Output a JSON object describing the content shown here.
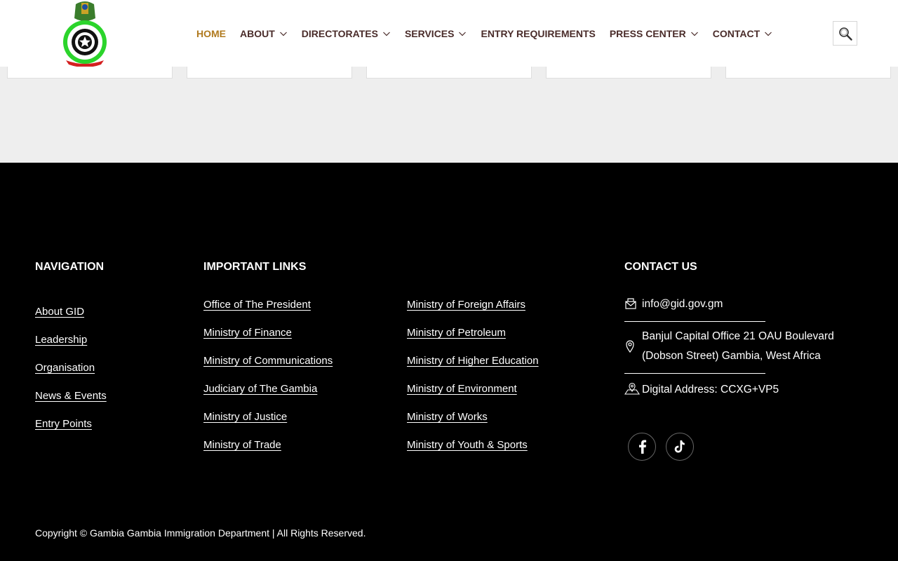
{
  "header": {
    "logo_icon": "gambia-immigration-crest-icon",
    "nav": [
      {
        "label": "HOME",
        "active": true,
        "has_dropdown": false
      },
      {
        "label": "ABOUT",
        "active": false,
        "has_dropdown": true
      },
      {
        "label": "DIRECTORATES",
        "active": false,
        "has_dropdown": true
      },
      {
        "label": "SERVICES",
        "active": false,
        "has_dropdown": true
      },
      {
        "label": "ENTRY REQUIREMENTS",
        "active": false,
        "has_dropdown": false
      },
      {
        "label": "PRESS CENTER",
        "active": false,
        "has_dropdown": true
      },
      {
        "label": "CONTACT",
        "active": false,
        "has_dropdown": true
      }
    ],
    "search_icon": "search-icon"
  },
  "footer": {
    "navigation": {
      "title": "NAVIGATION",
      "links": [
        "About GID",
        "Leadership",
        "Organisation",
        "News & Events",
        "Entry Points"
      ]
    },
    "important_links": {
      "title": "IMPORTANT LINKS",
      "col1": [
        "Office of The President",
        "Ministry of Finance",
        "Ministry of Communications",
        "Judiciary of The Gambia",
        "Ministry of Justice",
        "Ministry of Trade"
      ],
      "col2": [
        "Ministry of Foreign Affairs",
        "Ministry of Petroleum",
        "Ministry of Higher Education",
        "Ministry of Environment",
        "Ministry of Works",
        "Ministry of Youth & Sports"
      ]
    },
    "contact": {
      "title": "CONTACT US",
      "email": "info@gid.gov.gm",
      "address_line1": "Banjul Capital Office 21 OAU Boulevard",
      "address_line2": "(Dobson Street) Gambia, West Africa",
      "digital_address": "Digital Address: CCXG+VP5"
    },
    "social": [
      {
        "icon": "facebook-icon"
      },
      {
        "icon": "tiktok-icon"
      }
    ],
    "copyright": "Copyright © Gambia Gambia Immigration Department | All Rights Reserved."
  },
  "colors": {
    "nav_text": "#4a2c2a",
    "nav_active": "#b07a1e",
    "band_bg": "#eeeeee",
    "footer_bg": "#000000",
    "footer_text": "#ffffff"
  }
}
